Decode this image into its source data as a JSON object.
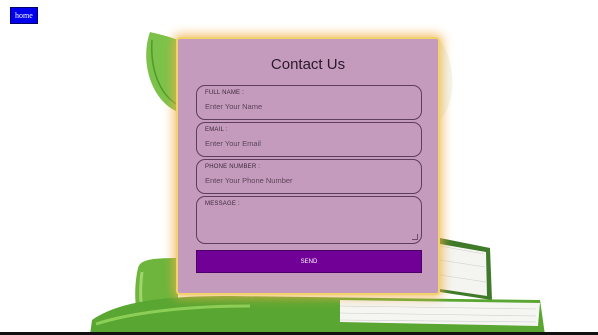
{
  "nav": {
    "home_label": "home"
  },
  "form": {
    "title": "Contact Us",
    "fields": [
      {
        "label": "FULL NAME :",
        "placeholder": "Enter Your Name"
      },
      {
        "label": "EMAIL :",
        "placeholder": "Enter Your Email"
      },
      {
        "label": "PHONE NUMBER :",
        "placeholder": "Enter Your Phone Number"
      },
      {
        "label": "MESSAGE :",
        "placeholder": ""
      }
    ],
    "send_label": "SEND"
  }
}
